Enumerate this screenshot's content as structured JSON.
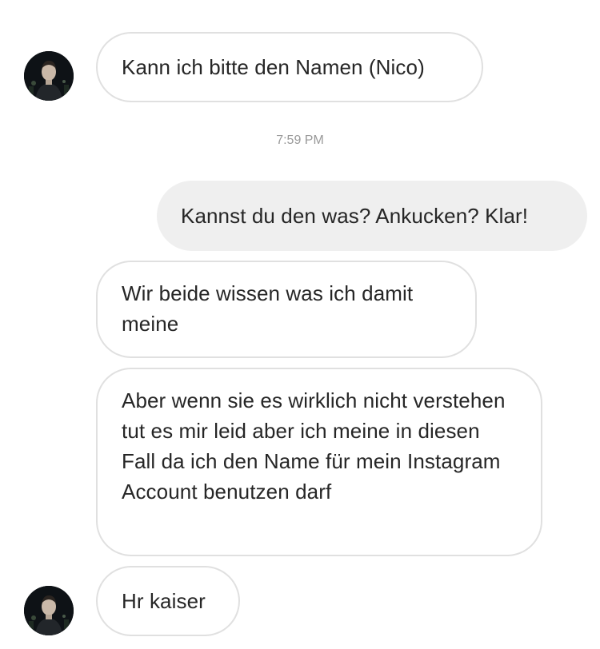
{
  "conversation": {
    "messages": [
      {
        "sender": "other",
        "text": "Kann ich bitte den Namen (Nico)"
      },
      {
        "sender": "me",
        "text": "Kannst du den was? Ankucken? Klar!"
      },
      {
        "sender": "other",
        "text": "Wir beide wissen was ich damit meine"
      },
      {
        "sender": "other",
        "text": "Aber wenn sie es wirklich nicht verstehen tut es mir leid aber ich meine in diesen Fall da ich den Name für mein Instagram Account benutzen darf"
      },
      {
        "sender": "other",
        "text": "Hr kaiser"
      }
    ],
    "timestamp": "7:59 PM"
  },
  "colors": {
    "incoming_border": "#e0e0e0",
    "outgoing_bg": "#efefef",
    "timestamp_text": "#999999",
    "message_text": "#262626"
  }
}
